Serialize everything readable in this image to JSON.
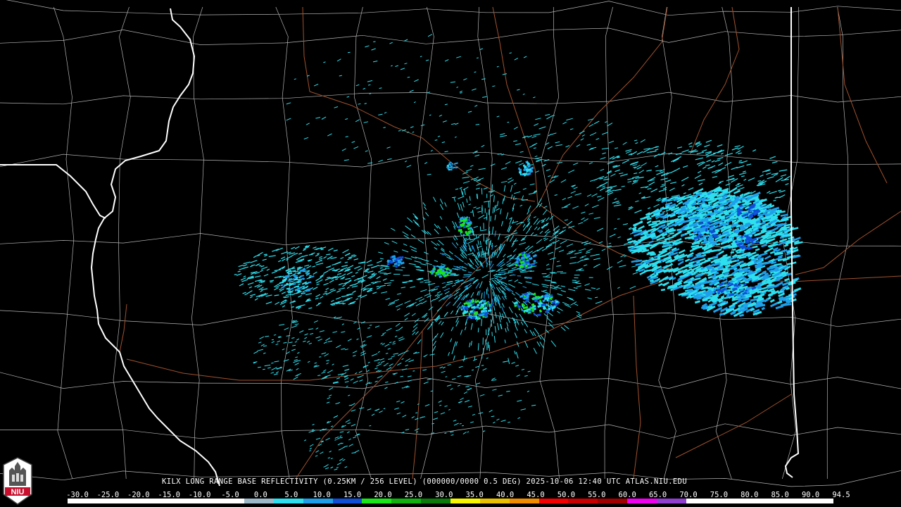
{
  "product": {
    "caption": "KILX LONG RANGE BASE REFLECTIVITY (0.25KM / 256 LEVEL) (000000/0000 0.5 DEG) 2025-10-06 12:40 UTC  ATLAS.NIU.EDU"
  },
  "logo": {
    "text": "NIU",
    "color": "#c8102e"
  },
  "color_scale": {
    "labels": [
      "-30.0",
      "-25.0",
      "-20.0",
      "-15.0",
      "-10.0",
      "-5.0",
      "0.0",
      "5.0",
      "10.0",
      "15.0",
      "20.0",
      "25.0",
      "30.0",
      "35.0",
      "40.0",
      "45.0",
      "50.0",
      "55.0",
      "60.0",
      "65.0",
      "70.0",
      "75.0",
      "80.0",
      "85.0",
      "90.0",
      "94.5"
    ],
    "colors": [
      "#ffffff",
      "#ffffff",
      "#ffffff",
      "#ffffff",
      "#ffffff",
      "#ffffff",
      "#9bb9c8",
      "#2ee0ef",
      "#1e9fea",
      "#0f4fd8",
      "#19e619",
      "#11b011",
      "#0a7a0a",
      "#f5f500",
      "#e8c000",
      "#f08c00",
      "#f50000",
      "#c80000",
      "#a00000",
      "#f000f0",
      "#9040d0",
      "#ffffff",
      "#ffffff",
      "#ffffff",
      "#ffffff",
      "#ffffff"
    ]
  },
  "map_colors": {
    "state_border": "#ffffff",
    "county_border": "#b4b4b4",
    "highway": "#a0522d"
  }
}
